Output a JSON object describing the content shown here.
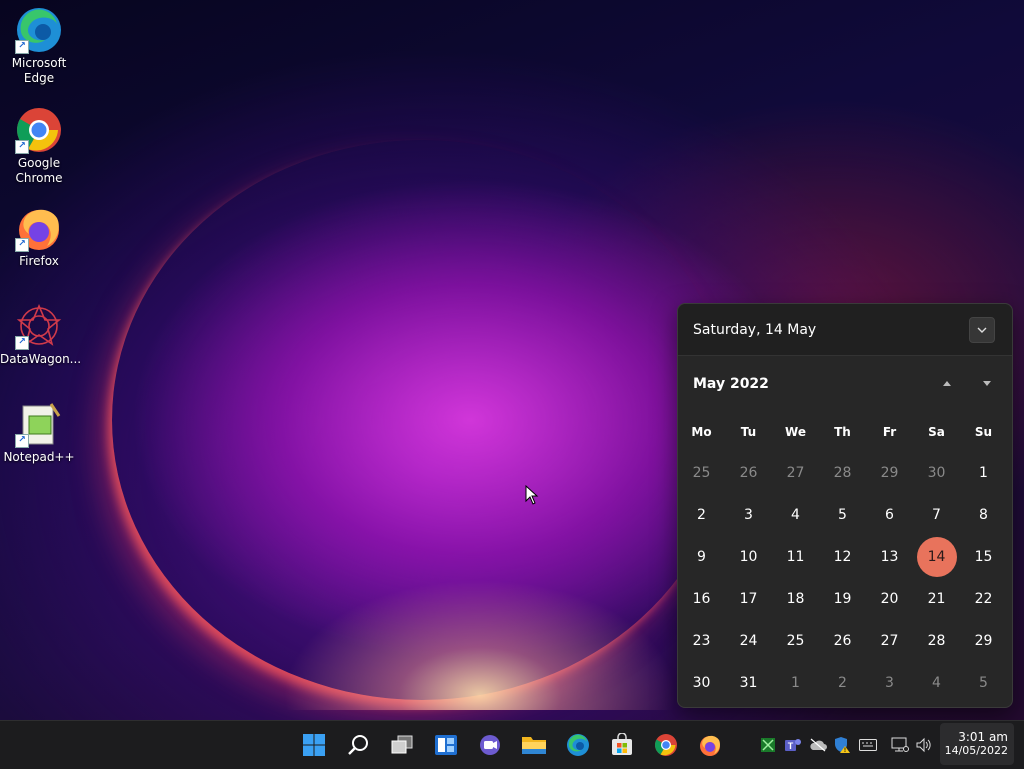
{
  "desktop": {
    "icons": [
      {
        "label_line1": "Microsoft",
        "label_line2": "Edge",
        "icon": "edge-icon"
      },
      {
        "label_line1": "Google",
        "label_line2": "Chrome",
        "icon": "chrome-icon"
      },
      {
        "label_line1": "Firefox",
        "label_line2": "",
        "icon": "firefox-icon"
      },
      {
        "label_line1": "DataWagon...",
        "label_line2": "",
        "icon": "datawagon-icon"
      },
      {
        "label_line1": "Notepad++",
        "label_line2": "",
        "icon": "notepadpp-icon"
      }
    ]
  },
  "calendar": {
    "header_date": "Saturday, 14 May",
    "month_label": "May 2022",
    "weekdays": [
      "Mo",
      "Tu",
      "We",
      "Th",
      "Fr",
      "Sa",
      "Su"
    ],
    "weeks": [
      [
        "25",
        "26",
        "27",
        "28",
        "29",
        "30",
        "1"
      ],
      [
        "2",
        "3",
        "4",
        "5",
        "6",
        "7",
        "8"
      ],
      [
        "9",
        "10",
        "11",
        "12",
        "13",
        "14",
        "15"
      ],
      [
        "16",
        "17",
        "18",
        "19",
        "20",
        "21",
        "22"
      ],
      [
        "23",
        "24",
        "25",
        "26",
        "27",
        "28",
        "29"
      ],
      [
        "30",
        "31",
        "1",
        "2",
        "3",
        "4",
        "5"
      ]
    ],
    "selected_day": "14",
    "accent_color": "#e8735c"
  },
  "taskbar": {
    "apps": [
      "start-icon",
      "search-icon",
      "task-view-icon",
      "widgets-icon",
      "chat-icon",
      "file-explorer-icon",
      "edge-icon",
      "store-icon",
      "chrome-icon",
      "firefox-icon"
    ],
    "tray": [
      "tray-app-icon",
      "teams-icon",
      "onedrive-icon",
      "security-icon",
      "keyboard-icon",
      "network-icon",
      "volume-icon"
    ],
    "time": "3:01 am",
    "date": "14/05/2022"
  }
}
